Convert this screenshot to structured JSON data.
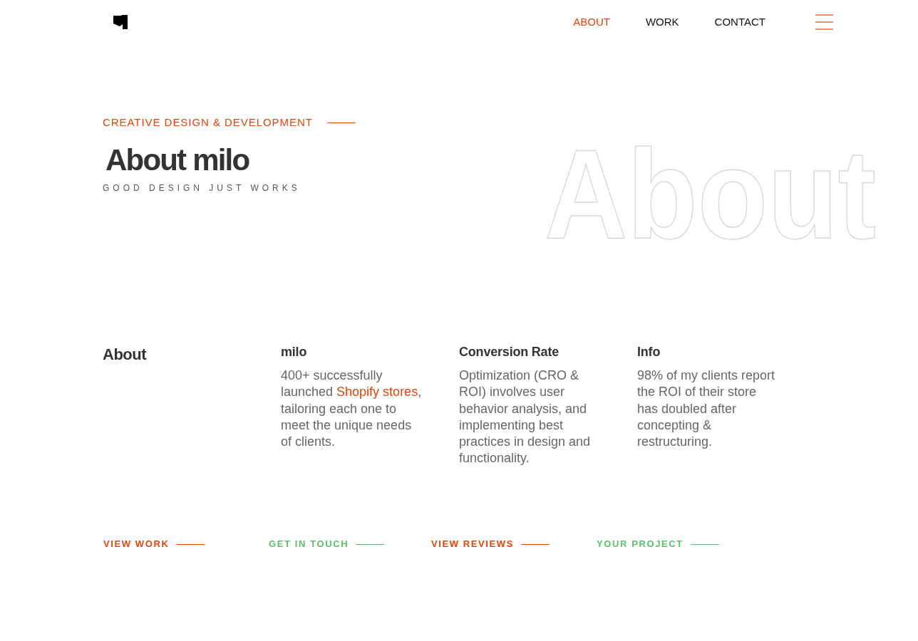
{
  "header": {
    "nav": [
      {
        "label": "ABOUT",
        "selected": true
      },
      {
        "label": "WORK",
        "selected": false
      },
      {
        "label": "CONTACT",
        "selected": false
      }
    ]
  },
  "hero": {
    "eyebrow": "CREATIVE DESIGN & DEVELOPMENT",
    "title": "About milo",
    "tagline": "GOOD DESIGN JUST WORKS",
    "backdrop_word": "About"
  },
  "about": {
    "heading": "About",
    "columns": [
      {
        "title": "milo",
        "body": [
          {
            "kind": "text",
            "text": "400+ successfully launched "
          },
          {
            "kind": "link",
            "text": "Shopify stores"
          },
          {
            "kind": "text",
            "text": ", tailoring each one to meet the unique needs of clients."
          }
        ]
      },
      {
        "title": "Conversion Rate",
        "body": [
          {
            "kind": "text",
            "text": "Optimization (CRO & ROI) involves user behavior analysis, and implementing best practices in design and functionality."
          }
        ]
      },
      {
        "title": "Info",
        "body": [
          {
            "kind": "text",
            "text": "98% of my clients report the ROI of their store has doubled after concepting & restructuring."
          }
        ]
      }
    ]
  },
  "links": [
    {
      "label": "VIEW WORK",
      "color": "#d9480f"
    },
    {
      "label": "GET IN TOUCH",
      "color": "#5cbf6b"
    },
    {
      "label": "VIEW REVIEWS",
      "color": "#d9480f"
    },
    {
      "label": "YOUR PROJECT",
      "color": "#5cbf6b"
    }
  ]
}
